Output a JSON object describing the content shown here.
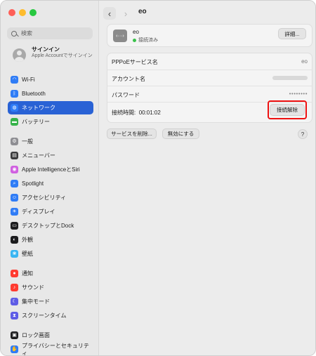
{
  "search": {
    "placeholder": "検索"
  },
  "account": {
    "name": "サインイン",
    "subtitle": "Apple Accountでサインイン"
  },
  "sidebar": {
    "items": [
      {
        "label": "Wi-Fi",
        "icon": "wifi-icon",
        "color": "#2f7cf6"
      },
      {
        "label": "Bluetooth",
        "icon": "bluetooth-icon",
        "color": "#2f7cf6"
      },
      {
        "label": "ネットワーク",
        "icon": "globe-icon",
        "color": "#2f7cf6",
        "selected": true
      },
      {
        "label": "バッテリー",
        "icon": "battery-icon",
        "color": "#36b34a"
      },
      {
        "label": "一般",
        "icon": "gear-icon",
        "color": "#8e8e93"
      },
      {
        "label": "メニューバー",
        "icon": "menubar-icon",
        "color": "#3a3a3c"
      },
      {
        "label": "Apple IntelligenceとSiri",
        "icon": "siri-icon",
        "color": "#d060e0"
      },
      {
        "label": "Spotlight",
        "icon": "spotlight-icon",
        "color": "#2f7cf6"
      },
      {
        "label": "アクセシビリティ",
        "icon": "accessibility-icon",
        "color": "#2f7cf6"
      },
      {
        "label": "ディスプレイ",
        "icon": "display-icon",
        "color": "#2f7cf6"
      },
      {
        "label": "デスクトップとDock",
        "icon": "dock-icon",
        "color": "#1c1c1e"
      },
      {
        "label": "外観",
        "icon": "appearance-icon",
        "color": "#1c1c1e"
      },
      {
        "label": "壁紙",
        "icon": "wallpaper-icon",
        "color": "#39b5f2"
      },
      {
        "label": "通知",
        "icon": "bell-icon",
        "color": "#ff3b30"
      },
      {
        "label": "サウンド",
        "icon": "speaker-icon",
        "color": "#ff3b30"
      },
      {
        "label": "集中モード",
        "icon": "moon-icon",
        "color": "#5e5ce6"
      },
      {
        "label": "スクリーンタイム",
        "icon": "hourglass-icon",
        "color": "#5e5ce6"
      },
      {
        "label": "ロック画面",
        "icon": "lock-icon",
        "color": "#1c1c1e"
      },
      {
        "label": "プライバシーとセキュリティ",
        "icon": "hand-icon",
        "color": "#2f7cf6"
      }
    ]
  },
  "header": {
    "title": "eo"
  },
  "service": {
    "name": "eo",
    "status": "接続済み",
    "details_label": "詳細...",
    "icon_glyph": "‹···›"
  },
  "fields": {
    "service_name_label": "PPPoEサービス名",
    "service_name_value": "eo",
    "account_label": "アカウント名",
    "password_label": "パスワード",
    "password_value": "••••••••",
    "time_label": "接続時間:",
    "time_value": "00:01:02",
    "disconnect_label": "接続解除"
  },
  "footer": {
    "delete_label": "サービスを削除...",
    "disable_label": "無効にする",
    "help_label": "?"
  },
  "colors": {
    "accent": "#2962d5",
    "highlight": "#e11111",
    "connected": "#3ac14b"
  }
}
